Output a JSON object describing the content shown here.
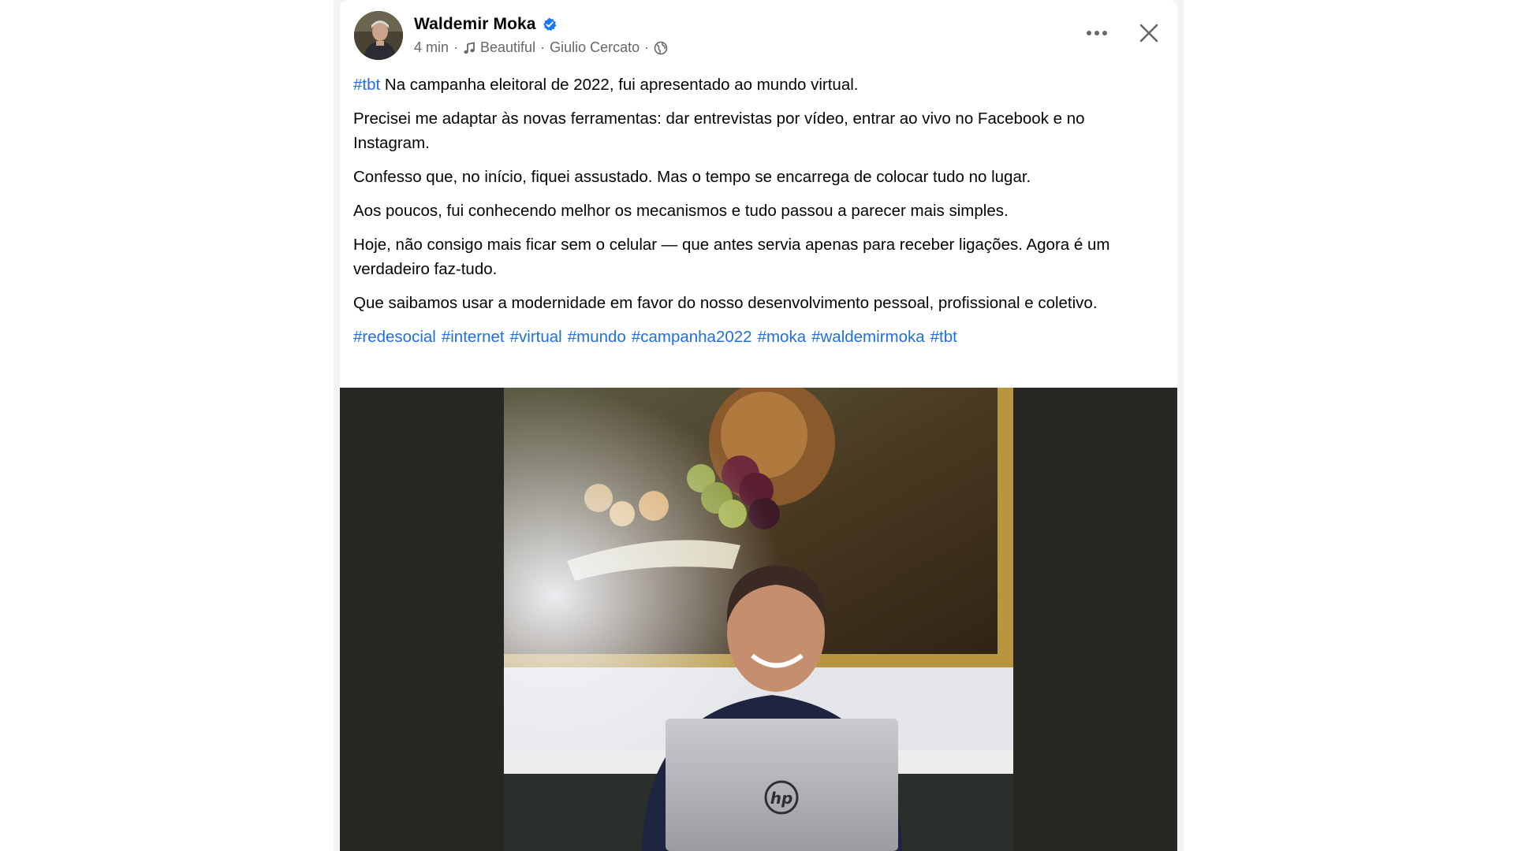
{
  "post": {
    "author": {
      "name": "Waldemir Moka",
      "verified": true
    },
    "meta": {
      "time": "4 min",
      "separator": "·",
      "music_icon": "music-note-icon",
      "audio_title": "Beautiful",
      "audio_artist": "Giulio Cercato",
      "privacy_icon": "globe-icon"
    },
    "actions": {
      "more_icon": "more-options-icon",
      "close_icon": "close-icon"
    },
    "text": {
      "p1_tag": "#tbt",
      "p1_rest": " Na campanha eleitoral de 2022, fui apresentado ao mundo virtual.",
      "p2": "Precisei me adaptar às novas ferramentas: dar entrevistas por vídeo, entrar ao vivo no Facebook e no Instagram.",
      "p3": "Confesso que, no início, fiquei assustado. Mas o tempo se encarrega de colocar tudo no lugar.",
      "p4": "Aos poucos, fui conhecendo melhor os mecanismos e tudo passou a parecer mais simples.",
      "p5": "Hoje, não consigo mais ficar sem o celular — que antes servia apenas para receber ligações. Agora é um verdadeiro faz-tudo.",
      "p6": "Que saibamos usar a modernidade em favor do nosso desenvolvimento pessoal, profissional e coletivo."
    },
    "hashtags": [
      "#redesocial",
      "#internet",
      "#virtual",
      "#mundo",
      "#campanha2022",
      "#moka",
      "#waldemirmoka",
      "#tbt"
    ],
    "media": {
      "laptop_logo": "hp"
    }
  },
  "colors": {
    "hashtag": "#216fdb",
    "verified_badge": "#1877f2",
    "secondary_text": "#65676b",
    "media_background": "#262623"
  }
}
